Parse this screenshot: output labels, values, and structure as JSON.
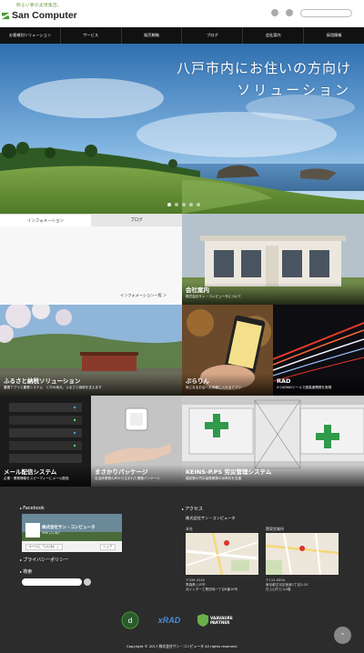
{
  "header": {
    "tagline": "明るい夢の実現集団。",
    "logo": "San Computer",
    "icons": [
      "user-icon",
      "mail-icon"
    ]
  },
  "nav": [
    "お客様別ソリューション",
    "サービス",
    "販売戦略",
    "ブログ",
    "会社案内",
    "採用情報"
  ],
  "hero": {
    "line1": "八戸市内にお住いの方向け",
    "line2": "ソリューション",
    "slides": 5,
    "active_slide": 1
  },
  "info": {
    "tabs": [
      "インフォメーション",
      "ブログ"
    ],
    "link": "インフォメーション一覧 ＞"
  },
  "tiles": {
    "company": {
      "title": "会社案内",
      "desc": "株式会社サン・コンピュータについて"
    },
    "furusato": {
      "title": "ふるさと納税ソリューション",
      "desc": "農業アプリと農業システム　とやの地元、ふるさと納税を支えます"
    },
    "burarin": {
      "title": "ぶらりん",
      "desc": "気になるお店へお気軽に入れるアプリ"
    },
    "rad": {
      "title": "RAD",
      "desc": "4つのRADツールで超高速開発を実現"
    },
    "mail": {
      "title": "メール配信システム",
      "desc": "企業・業務情報をスピーディーにメール配信"
    },
    "package": {
      "title": "まさかりパッケージ",
      "desc": "自治体業務の声から生まれた業務パッケージ"
    },
    "keins": {
      "title": "KEINS-P.PS 労災管理システム",
      "desc": "建設業の労災保険業務の効率化を支援"
    }
  },
  "footer": {
    "facebook": "Facebook",
    "fb_page": "株式会社サン・コンピュータ",
    "fb_likes": "596 いいね！",
    "fb_like_btn": "ページに「いいね！」",
    "fb_share": "シェア",
    "privacy": "プライバシーポリシー",
    "search": "検索",
    "access": "アクセス",
    "company": "株式会社サン・コンピュータ",
    "honsha": "本社",
    "tokyo": "関東営業所",
    "addr1": "〒039-2245\n青森県八戸市\n北インター工業団地一丁目6番16号",
    "addr2": "〒112-0004\n東京都文京区後楽1丁目3-20\n白上山竹ビル4階",
    "badges": [
      "d-badge",
      "xRAD",
      "VAAVAURE PARTNER"
    ],
    "copyright": "Copyright © 2017 株式会社サン・コンピュータ All rights reserved."
  },
  "colors": {
    "nav": "#111111",
    "footer": "#2c2c2c",
    "brand": "#4a9a3a"
  }
}
